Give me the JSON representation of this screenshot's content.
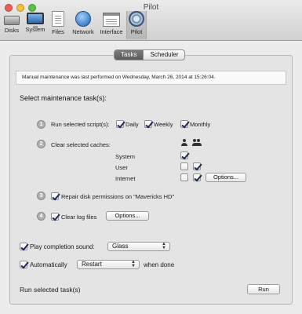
{
  "window": {
    "title": "Pilot"
  },
  "toolbar": {
    "items": [
      {
        "label": "Disks",
        "icon": "disk-icon"
      },
      {
        "label": "System",
        "icon": "monitor-icon"
      },
      {
        "label": "Files",
        "icon": "document-icon"
      },
      {
        "label": "Network",
        "icon": "globe-icon"
      },
      {
        "label": "Interface",
        "icon": "window-icon"
      },
      {
        "label": "Pilot",
        "icon": "pilot-icon",
        "selected": true
      }
    ]
  },
  "tabs": [
    {
      "label": "Tasks",
      "active": true
    },
    {
      "label": "Scheduler",
      "active": false
    }
  ],
  "info": {
    "text": "Manual maintenance was last performed on Wednesday, March 26, 2014 at 15:26:04."
  },
  "section": {
    "heading": "Select maintenance task(s):"
  },
  "tasks": {
    "t1": {
      "num": "1",
      "label": "Run selected script(s):",
      "daily": {
        "label": "Daily",
        "checked": true
      },
      "weekly": {
        "label": "Weekly",
        "checked": true
      },
      "monthly": {
        "label": "Monthly",
        "checked": true
      }
    },
    "t2": {
      "num": "2",
      "label": "Clear selected caches:",
      "rows": {
        "system": {
          "label": "System",
          "user_checked": true,
          "group_checked": null
        },
        "user": {
          "label": "User",
          "user_checked": false,
          "group_checked": true
        },
        "internet": {
          "label": "Internet",
          "user_checked": false,
          "group_checked": true
        }
      },
      "options_label": "Options..."
    },
    "t3": {
      "num": "3",
      "label": "Repair disk permissions on \"Mavericks HD\"",
      "checked": true
    },
    "t4": {
      "num": "4",
      "label": "Clear log files",
      "checked": true,
      "options_label": "Options..."
    }
  },
  "sound": {
    "label": "Play completion sound:",
    "checked": true,
    "value": "Glass"
  },
  "auto": {
    "label": "Automatically",
    "checked": true,
    "value": "Restart",
    "suffix": "when done"
  },
  "footer": {
    "label": "Run selected task(s)",
    "run_label": "Run"
  },
  "colors": {
    "accent_check": "#1e2a55",
    "selected_tab": "#5a5a5a"
  }
}
